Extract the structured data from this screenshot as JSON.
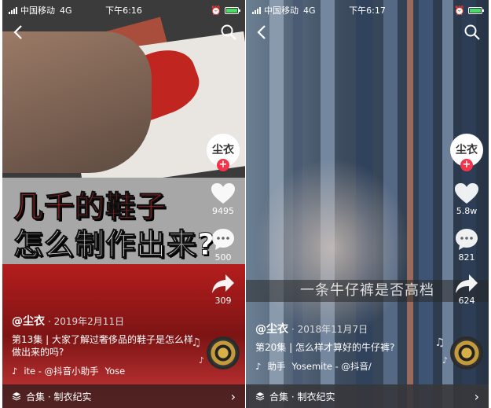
{
  "phones": [
    {
      "status": {
        "carrier": "中国移动",
        "network": "4G",
        "time": "下午6:16"
      },
      "overlay_title_line1": "几千的鞋子",
      "overlay_title_line2": "怎么制作出来?",
      "avatar_text": "尘衣",
      "likes": "9495",
      "comments": "500",
      "shares": "309",
      "username": "@尘衣",
      "date": "· 2019年2月11日",
      "description": "第13集 | 大家了解过奢侈品的鞋子是怎么样做出来的吗?",
      "music": [
        "ite - @抖音小助手",
        "Yose"
      ],
      "collection": "合集 · 制衣纪实"
    },
    {
      "status": {
        "carrier": "中国移动",
        "network": "4G",
        "time": "下午6:17"
      },
      "subtitle": "一条牛仔裤是否高档",
      "avatar_text": "尘衣",
      "likes": "5.8w",
      "comments": "821",
      "shares": "624",
      "username": "@尘衣",
      "date": "· 2018年11月7日",
      "description": "第20集 | 怎么样才算好的牛仔裤?",
      "music": [
        "助手",
        "Yosemite - @抖音/"
      ],
      "collection": "合集 · 制衣纪实"
    }
  ],
  "icons": [
    "back-icon",
    "search-icon",
    "heart-icon",
    "comment-icon",
    "share-icon",
    "music-note-icon",
    "collection-icon",
    "chevron-right-icon"
  ],
  "colors": {
    "like_plus": "#f5334b",
    "title_red": "#d62424",
    "battery_green": "#4cd964"
  }
}
